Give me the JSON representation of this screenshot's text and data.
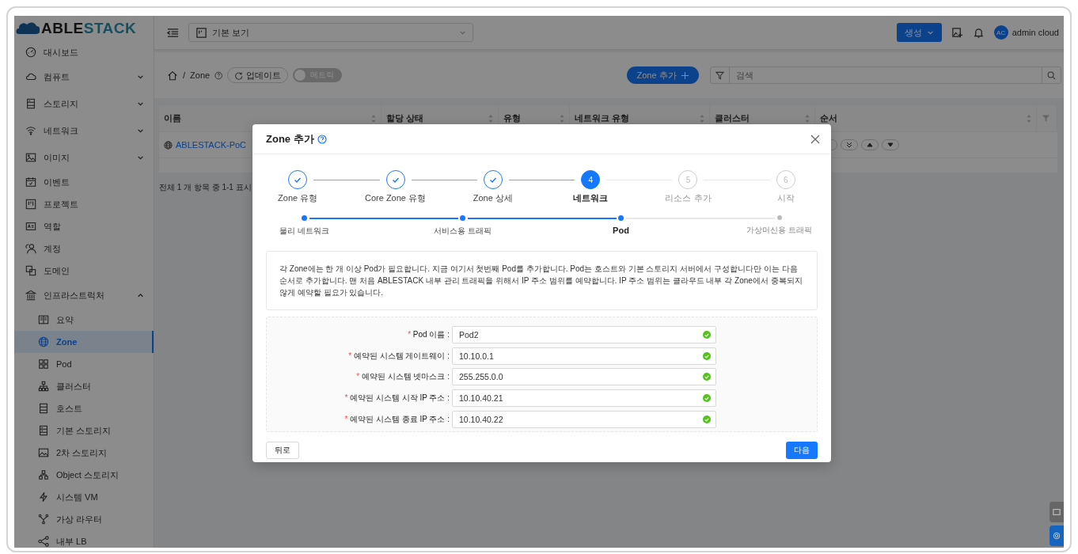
{
  "sidebar": {
    "logo": {
      "prefix": "ABLE",
      "suffix": "STACK"
    },
    "items": [
      {
        "label": "대시보드",
        "selected": false
      },
      {
        "label": "컴퓨트",
        "expanded": false,
        "selected": false
      },
      {
        "label": "스토리지",
        "expanded": false,
        "selected": false
      },
      {
        "label": "네트워크",
        "expanded": false,
        "selected": false
      },
      {
        "label": "이미지",
        "expanded": false,
        "selected": false
      },
      {
        "label": "이벤트",
        "selected": false
      },
      {
        "label": "프로젝트",
        "selected": false
      },
      {
        "label": "역할",
        "selected": false
      },
      {
        "label": "계정",
        "selected": false
      },
      {
        "label": "도메인",
        "selected": false
      },
      {
        "label": "인프라스트럭처",
        "expanded": true,
        "selected": false,
        "children": [
          {
            "label": "요약",
            "selected": false
          },
          {
            "label": "Zone",
            "selected": true
          },
          {
            "label": "Pod",
            "selected": false
          },
          {
            "label": "클러스터",
            "selected": false
          },
          {
            "label": "호스트",
            "selected": false
          },
          {
            "label": "기본 스토리지",
            "selected": false
          },
          {
            "label": "2차 스토리지",
            "selected": false
          },
          {
            "label": "Object 스토리지",
            "selected": false
          },
          {
            "label": "시스템 VM",
            "selected": false
          },
          {
            "label": "가상 라우터",
            "selected": false
          },
          {
            "label": "내부 LB",
            "selected": false
          }
        ]
      }
    ]
  },
  "header": {
    "view_select": "기본 보기",
    "create_button": "생성",
    "avatar": "AC",
    "user_name": "admin cloud"
  },
  "toolbar": {
    "breadcrumb": "Zone",
    "separator": "/",
    "refresh_button": "업데이트",
    "metrics_toggle": {
      "label": "메트릭",
      "on": false
    },
    "add_button": "Zone 추가",
    "search": {
      "placeholder": "검색"
    }
  },
  "table": {
    "columns": [
      "이름",
      "할당 상태",
      "유형",
      "네트워크 유형",
      "클러스터",
      "순서"
    ],
    "rows": [
      {
        "name": "ABLESTACK-PoC"
      }
    ],
    "footer": "전체 1 개 항목 중 1-1 표시"
  },
  "modal": {
    "title": "Zone 추가",
    "steps": [
      {
        "label": "Zone 유형",
        "done": true,
        "current": false
      },
      {
        "label": "Core Zone 유형",
        "done": true,
        "current": false
      },
      {
        "label": "Zone 상세",
        "done": true,
        "current": false
      },
      {
        "label": "네트워크",
        "number": "4",
        "done": false,
        "current": true
      },
      {
        "label": "리소스 추가",
        "number": "5",
        "done": false,
        "current": false
      },
      {
        "label": "시작",
        "number": "6",
        "done": false,
        "current": false
      }
    ],
    "substeps": [
      {
        "label": "물리 네트워크",
        "done": true,
        "current": false
      },
      {
        "label": "서비스용 트래픽",
        "done": true,
        "current": false
      },
      {
        "label": "Pod",
        "done": false,
        "current": true
      },
      {
        "label": "가상머신용 트래픽",
        "done": false,
        "current": false
      }
    ],
    "description": "각 Zone에는 한 개 이상 Pod가 필요합니다. 지금 여기서 첫번째 Pod를 추가합니다. Pod는 호스트와 기본 스토리지 서버에서 구성합니다만 이는 다음 순서로 추가합니다. 맨 처음 ABLESTACK 내부 관리 트래픽을 위해서 IP 주소 범위를 예약합니다. IP 주소 범위는 클라우드 내부 각 Zone에서 중복되지 않게 예약할 필요가 있습니다.",
    "fields": [
      {
        "marker": "*",
        "label": "Pod 이름 :",
        "value": "Pod2",
        "valid": true
      },
      {
        "marker": "*",
        "label": "예약된 시스템 게이트웨이 :",
        "value": "10.10.0.1",
        "valid": true
      },
      {
        "marker": "*",
        "label": "예약된 시스템 넷마스크 :",
        "value": "255.255.0.0",
        "valid": true
      },
      {
        "marker": "*",
        "label": "예약된 시스템 시작 IP 주소 :",
        "value": "10.10.40.21",
        "valid": true
      },
      {
        "marker": "*",
        "label": "예약된 시스템 종료 IP 주소 :",
        "value": "10.10.40.22",
        "valid": true
      }
    ],
    "back_button": "뒤로",
    "next_button": "다음"
  }
}
